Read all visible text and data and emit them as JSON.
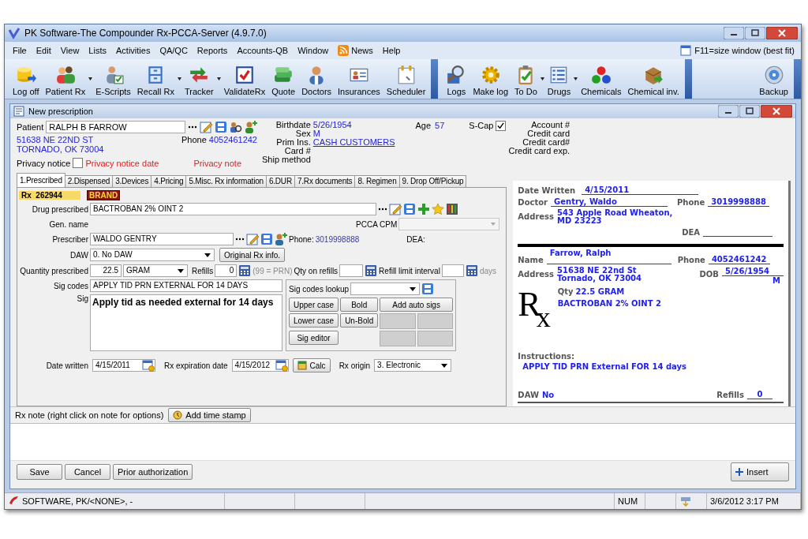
{
  "window": {
    "title": "PK Software-The Compounder Rx-PCCA-Server (4.9.7.0)"
  },
  "menu": [
    {
      "label": "File",
      "kind": "plain"
    },
    {
      "label": "Edit",
      "kind": "plain"
    },
    {
      "label": "View",
      "kind": "plain"
    },
    {
      "label": "Lists",
      "kind": "plain"
    },
    {
      "label": "Activities",
      "kind": "plain"
    },
    {
      "label": "QA/QC",
      "kind": "plain"
    },
    {
      "label": "Reports",
      "kind": "plain"
    },
    {
      "label": "Accounts-QB",
      "kind": "plain"
    },
    {
      "label": "Window",
      "kind": "plain"
    },
    {
      "label": "News",
      "kind": "feed"
    },
    {
      "label": "Help",
      "kind": "plain"
    }
  ],
  "size_hint": "F11=size window (best fit)",
  "toolbar": [
    [
      {
        "label": "Log off",
        "dropdown": false
      },
      {
        "label": "Patient Rx",
        "dropdown": true
      },
      {
        "label": "E-Scripts",
        "dropdown": false
      },
      {
        "label": "Recall Rx",
        "dropdown": true
      },
      {
        "label": "Tracker",
        "dropdown": true
      },
      {
        "label": "ValidateRx",
        "dropdown": false
      },
      {
        "label": "Quote",
        "dropdown": false
      },
      {
        "label": "Doctors",
        "dropdown": false
      },
      {
        "label": "Insurances",
        "dropdown": false
      },
      {
        "label": "Scheduler",
        "dropdown": false
      }
    ],
    [
      {
        "label": "Logs",
        "dropdown": false
      },
      {
        "label": "Make log",
        "dropdown": false
      },
      {
        "label": "To Do",
        "dropdown": true
      },
      {
        "label": "Drugs",
        "dropdown": true
      },
      {
        "label": "Chemicals",
        "dropdown": false
      },
      {
        "label": "Chemical inv.",
        "dropdown": false
      }
    ],
    [
      {
        "label": "Backup",
        "dropdown": false
      }
    ]
  ],
  "child_window": {
    "title": "New prescription"
  },
  "patient": {
    "label": "Patient",
    "name": "RALPH B FARROW",
    "address_lines": [
      "51638 NE 22ND ST",
      "TORNADO, OK 73004"
    ],
    "phone_label": "Phone",
    "phone": "4052461242",
    "privacy_label": "Privacy notice",
    "privacy_checked": false,
    "privacy_date_label": "Privacy notice date",
    "privacy_note_label": "Privacy note",
    "info": [
      {
        "label": "Birthdate",
        "value": "5/26/1954",
        "kind": "text"
      },
      {
        "label": "Sex",
        "value": "M",
        "kind": "text"
      },
      {
        "label": "Prim Ins.",
        "value": "CASH CUSTOMERS",
        "kind": "link"
      },
      {
        "label": "Card #"
      },
      {
        "label": "Ship method"
      }
    ],
    "age_label": "Age",
    "age": "57",
    "scap_label": "S-Cap",
    "scap_checked": true,
    "account": [
      "Account #",
      "Credit card",
      "Credit card#",
      "Credit card exp."
    ]
  },
  "tabs": [
    {
      "label": "1.Prescribed",
      "selected": true
    },
    {
      "label": "2.Dispensed",
      "selected": false
    },
    {
      "label": "3.Devices",
      "selected": false
    },
    {
      "label": "4.Pricing",
      "selected": false
    },
    {
      "label": "5.Misc. Rx information",
      "selected": false
    },
    {
      "label": "6.DUR",
      "selected": false
    },
    {
      "label": "7.Rx documents",
      "selected": false
    },
    {
      "label": "8. Regimen",
      "selected": false
    },
    {
      "label": "9. Drop Off/Pickup",
      "selected": false
    }
  ],
  "rx": {
    "label": "Rx",
    "number": "262944",
    "badge": "BRAND"
  },
  "form": {
    "drug_label": "Drug prescribed",
    "drug": "BACTROBAN 2% OINT 2",
    "gen_name_label": "Gen. name",
    "pcca_label": "PCCA CPM",
    "prescriber_label": "Prescriber",
    "prescriber": "WALDO  GENTRY",
    "phone_label": "Phone:",
    "phone": "3019998888",
    "dea_label": "DEA:",
    "daw_label": "DAW",
    "daw": "0.  No DAW",
    "original_button": "Original Rx info.",
    "qty_label": "Quantity prescribed",
    "qty": "22.5",
    "unit": "GRAM",
    "refills_label": "Refills",
    "refills": "0",
    "prn_hint": "(99 = PRN)",
    "qty_refills_label": "Qty on refills",
    "refill_interval_label": "Refill limit interval",
    "days_label": "days",
    "sig_codes_label": "Sig codes",
    "sig_codes": "APPLY TID PRN EXTERNAL FOR 14 DAYS",
    "sig_label": "Sig",
    "sig": "Apply tid as needed external for 14 days",
    "lookup_label": "Sig codes lookup",
    "sig_buttons": [
      "Upper case",
      "Bold",
      "Lower case",
      "Un-Bold",
      "Sig editor"
    ],
    "auto_sigs_button": "Add auto sigs",
    "date_written_label": "Date written",
    "date_written": "4/15/2011",
    "expiration_label": "Rx expiration date",
    "expiration": "4/15/2012",
    "calc_button": "Calc",
    "origin_label": "Rx origin",
    "origin": "3.  Electronic"
  },
  "rx_paper": {
    "date_written_label": "Date Written",
    "date_written": "4/15/2011",
    "doctor_label": "Doctor",
    "doctor": "Gentry, Waldo",
    "doctor_phone_label": "Phone",
    "doctor_phone": "3019998888",
    "doctor_address_label": "Address",
    "doctor_address": "543 Apple Road  Wheaton, MD 23223",
    "dea_label": "DEA",
    "name_label": "Name",
    "patient_name": "Farrow, Ralph",
    "patient_phone_label": "Phone",
    "patient_phone": "4052461242",
    "patient_address_label": "Address",
    "patient_address": "51638 NE 22nd St Tornado, OK 73004",
    "dob_label": "DOB",
    "dob": "5/26/1954",
    "sex": "M",
    "rx_symbol": "R$_{x}$",
    "qty_label": "Qty",
    "qty": "22.5 GRAM",
    "drug": "BACTROBAN 2% OINT 2",
    "instructions_label": "Instructions:",
    "instructions": "APPLY TID PRN External FOR 14 days",
    "daw_label": "DAW",
    "daw": "No",
    "refills_label": "Refills",
    "refills": "0"
  },
  "note": {
    "label": "Rx note (right click on note for options)",
    "stamp_button": "Add time stamp"
  },
  "buttons": [
    "Save",
    "Cancel",
    "Prior authorization"
  ],
  "insert_button": "Insert",
  "status_bar": {
    "user": "SOFTWARE, PK/<NONE>, -",
    "num": "NUM",
    "datetime": "3/6/2012 3:17 PM"
  }
}
